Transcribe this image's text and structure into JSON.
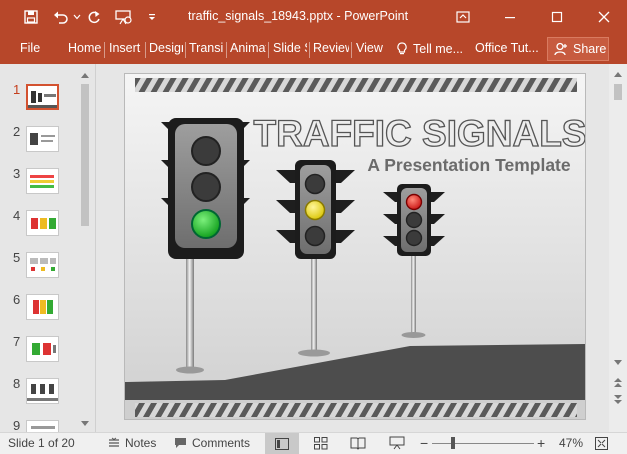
{
  "window": {
    "title": "traffic_signals_18943.pptx - PowerPoint",
    "accent": "#b7472a"
  },
  "ribbon": {
    "tabs": [
      {
        "label": "File"
      },
      {
        "label": "Home"
      },
      {
        "label": "Insert"
      },
      {
        "label": "Design"
      },
      {
        "label": "Transitions"
      },
      {
        "label": "Animations"
      },
      {
        "label": "Slide Show"
      },
      {
        "label": "Review"
      },
      {
        "label": "View"
      },
      {
        "label": "Tell me..."
      },
      {
        "label": "Office Tut..."
      }
    ],
    "share_label": "Share"
  },
  "thumbnails": [
    {
      "number": "1"
    },
    {
      "number": "2"
    },
    {
      "number": "3"
    },
    {
      "number": "4"
    },
    {
      "number": "5"
    },
    {
      "number": "6"
    },
    {
      "number": "7"
    },
    {
      "number": "8"
    },
    {
      "number": "9"
    }
  ],
  "slide": {
    "title": "TRAFFIC SIGNALS",
    "subtitle": "A Presentation Template"
  },
  "status": {
    "slide_info": "Slide 1 of 20",
    "notes_label": "Notes",
    "comments_label": "Comments",
    "zoom": "47%",
    "zoom_level": 0.47
  }
}
